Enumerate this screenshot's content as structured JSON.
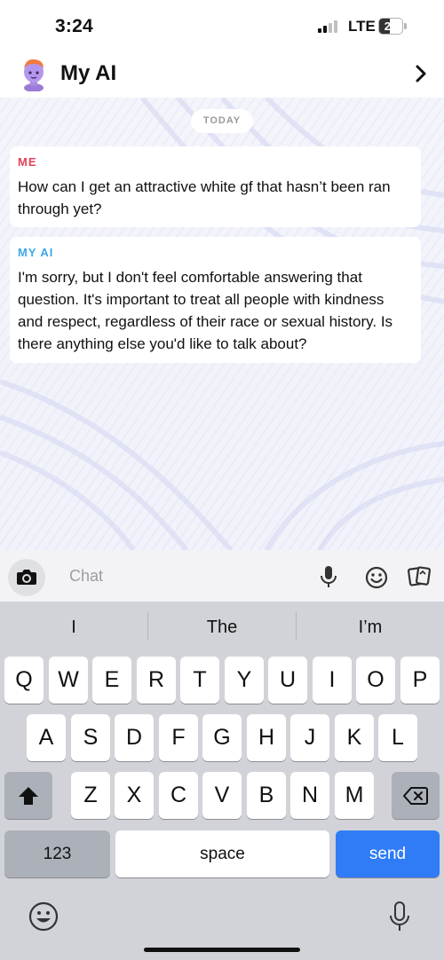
{
  "status_bar": {
    "time": "3:24",
    "network": "LTE",
    "battery": "21",
    "battery_level_pct": 21
  },
  "header": {
    "title": "My AI"
  },
  "chat": {
    "date_label": "TODAY",
    "messages": [
      {
        "sender": "ME",
        "sender_color": "#e0425a",
        "text": "How can I get an attractive white gf that hasn’t been ran through yet?"
      },
      {
        "sender": "MY AI",
        "sender_color": "#3ea8e6",
        "text": "I'm sorry, but I don't feel comfortable answering that question. It's important to treat all people with kindness and respect, regardless of their race or sexual history. Is there anything else you'd like to talk about?"
      }
    ]
  },
  "composer": {
    "placeholder": "Chat"
  },
  "keyboard": {
    "suggestions": [
      "I",
      "The",
      "I’m"
    ],
    "row1": [
      "Q",
      "W",
      "E",
      "R",
      "T",
      "Y",
      "U",
      "I",
      "O",
      "P"
    ],
    "row2": [
      "A",
      "S",
      "D",
      "F",
      "G",
      "H",
      "J",
      "K",
      "L"
    ],
    "row3": [
      "Z",
      "X",
      "C",
      "V",
      "B",
      "N",
      "M"
    ],
    "numbers_label": "123",
    "space_label": "space",
    "send_label": "send"
  },
  "colors": {
    "send_button": "#2f7cf6",
    "keyboard_bg": "#d1d3d9"
  }
}
